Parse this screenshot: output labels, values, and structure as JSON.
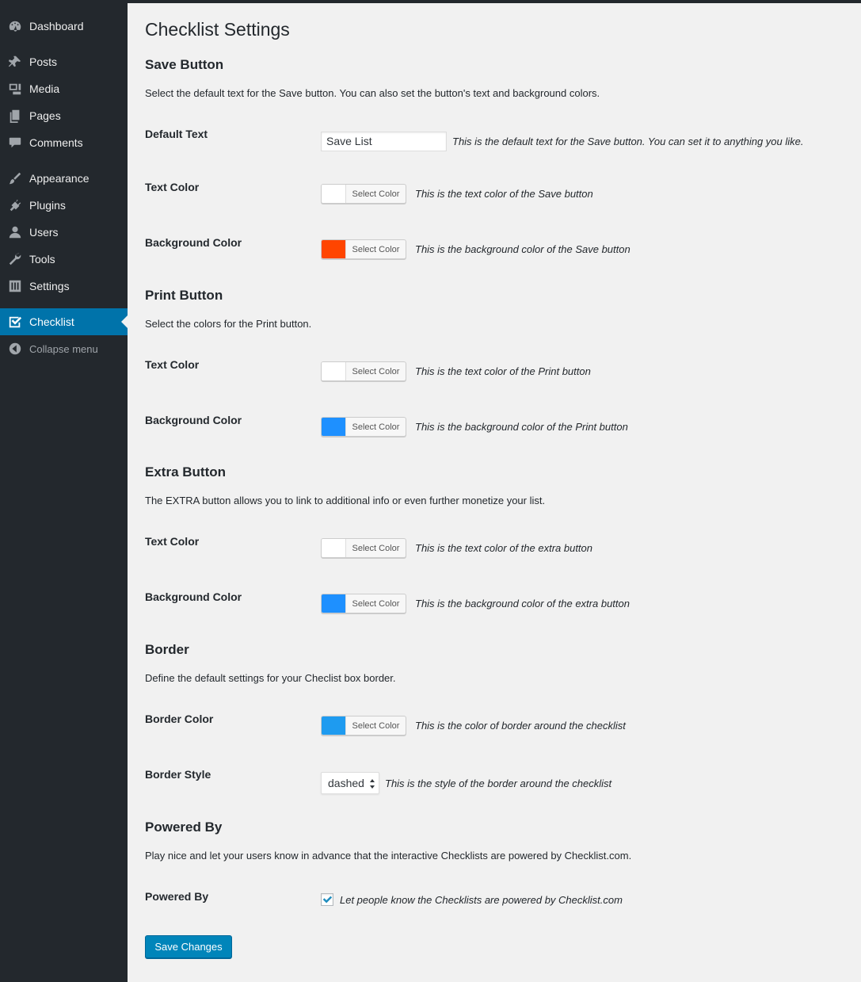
{
  "sidebar": {
    "items": [
      {
        "label": "Dashboard",
        "icon": "dashboard-icon"
      },
      {
        "label": "Posts",
        "icon": "pin-icon"
      },
      {
        "label": "Media",
        "icon": "media-icon"
      },
      {
        "label": "Pages",
        "icon": "pages-icon"
      },
      {
        "label": "Comments",
        "icon": "comment-icon"
      },
      {
        "label": "Appearance",
        "icon": "brush-icon"
      },
      {
        "label": "Plugins",
        "icon": "plug-icon"
      },
      {
        "label": "Users",
        "icon": "user-icon"
      },
      {
        "label": "Tools",
        "icon": "wrench-icon"
      },
      {
        "label": "Settings",
        "icon": "sliders-icon"
      },
      {
        "label": "Checklist",
        "icon": "checkbox-icon",
        "active": true
      },
      {
        "label": "Collapse menu",
        "icon": "collapse-icon"
      }
    ]
  },
  "page": {
    "title": "Checklist Settings"
  },
  "sections": {
    "save": {
      "heading": "Save Button",
      "description": "Select the default text for the Save button. You can also set the button's text and background colors.",
      "default_text_label": "Default Text",
      "default_text_value": "Save List",
      "default_text_hint": "This is the default text for the Save button. You can set it to anything you like.",
      "text_color_label": "Text Color",
      "text_color_hint": "This is the text color of the Save button",
      "bg_color_label": "Background Color",
      "bg_color_hint": "This is the background color of the Save button"
    },
    "print": {
      "heading": "Print Button",
      "description": "Select the colors for the Print button.",
      "text_color_label": "Text Color",
      "text_color_hint": "This is the text color of the Print button",
      "bg_color_label": "Background Color",
      "bg_color_hint": "This is the background color of the Print button"
    },
    "extra": {
      "heading": "Extra Button",
      "description": "The EXTRA button allows you to link to additional info or even further monetize your list.",
      "text_color_label": "Text Color",
      "text_color_hint": "This is the text color of the extra button",
      "bg_color_label": "Background Color",
      "bg_color_hint": "This is the background color of the extra button"
    },
    "border": {
      "heading": "Border",
      "description": "Define the default settings for your Checlist box border.",
      "color_label": "Border Color",
      "color_hint": "This is the color of border around the checklist",
      "style_label": "Border Style",
      "style_value": "dashed",
      "style_hint": "This is the style of the border around the checklist"
    },
    "powered": {
      "heading": "Powered By",
      "description": "Play nice and let your users know in advance that the interactive Checklists are powered by Checklist.com.",
      "label": "Powered By",
      "checkbox_checked": true,
      "checkbox_hint": "Let people know the Checklists are powered by Checklist.com"
    }
  },
  "color_picker": {
    "button_label": "Select Color"
  },
  "colors": {
    "save_text": "#ffffff",
    "save_bg": "#ff4500",
    "print_text": "#ffffff",
    "print_bg": "#1e90ff",
    "extra_text": "#ffffff",
    "extra_bg": "#1e90ff",
    "border": "#1e9bf0",
    "primary": "#0085ba",
    "sidebar_bg": "#23282d",
    "sidebar_active": "#0073aa"
  },
  "actions": {
    "save_label": "Save Changes"
  }
}
